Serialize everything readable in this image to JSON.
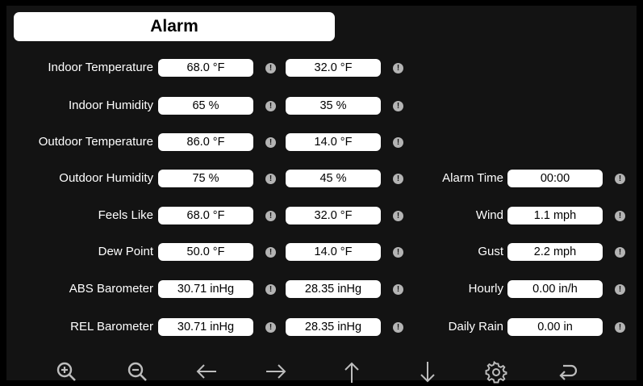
{
  "header": {
    "title": "Alarm"
  },
  "left_rows": [
    {
      "label": "Indoor Temperature",
      "high": "68.0 °F",
      "low": "32.0 °F"
    },
    {
      "label": "Indoor Humidity",
      "high": "65 %",
      "low": "35 %"
    },
    {
      "label": "Outdoor Temperature",
      "high": "86.0 °F",
      "low": "14.0 °F"
    },
    {
      "label": "Outdoor Humidity",
      "high": "75 %",
      "low": "45 %"
    },
    {
      "label": "Feels Like",
      "high": "68.0 °F",
      "low": "32.0 °F"
    },
    {
      "label": "Dew Point",
      "high": "50.0 °F",
      "low": "14.0 °F"
    },
    {
      "label": "ABS Barometer",
      "high": "30.71 inHg",
      "low": "28.35 inHg"
    },
    {
      "label": "REL Barometer",
      "high": "30.71 inHg",
      "low": "28.35 inHg"
    }
  ],
  "right_rows": [
    {
      "label": "Alarm Time",
      "value": "00:00"
    },
    {
      "label": "Wind",
      "value": "1.1 mph"
    },
    {
      "label": "Gust",
      "value": "2.2 mph"
    },
    {
      "label": "Hourly",
      "value": "0.00 in/h"
    },
    {
      "label": "Daily Rain",
      "value": "0.00 in"
    }
  ],
  "indicator_glyph": "!",
  "toolbar": [
    {
      "name": "zoom-in-icon"
    },
    {
      "name": "zoom-out-icon"
    },
    {
      "name": "arrow-left-icon"
    },
    {
      "name": "arrow-right-icon"
    },
    {
      "name": "arrow-up-icon"
    },
    {
      "name": "arrow-down-icon"
    },
    {
      "name": "gear-icon"
    },
    {
      "name": "back-icon"
    }
  ],
  "colors": {
    "background": "#000000",
    "panel": "#131313",
    "field": "#ffffff",
    "indicator": "#b4b4b4",
    "icon": "#bdbdbd"
  }
}
